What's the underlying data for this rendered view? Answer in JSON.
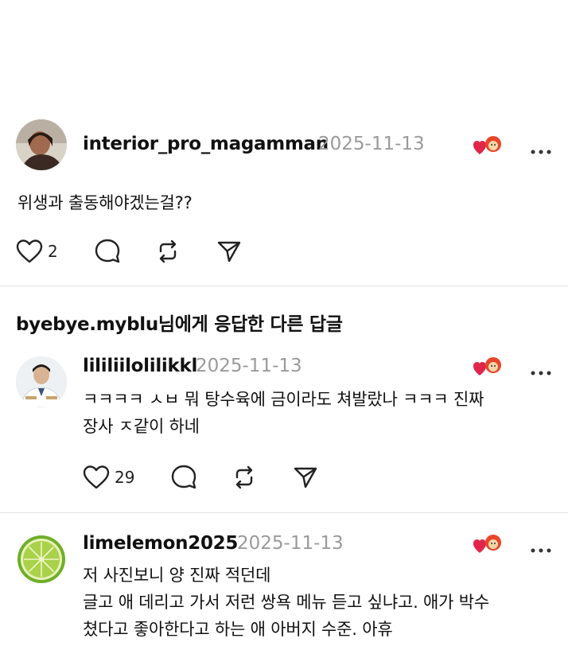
{
  "posts": [
    {
      "username": "interior_pro_magamman",
      "date": "2025-11-13",
      "lines": [
        "위생과 출동해야겠는걸??"
      ],
      "likes": "2",
      "avatar": "person-photo-avatar"
    },
    {
      "username": "lililiilolilikkl",
      "date": "2025-11-13",
      "lines": [
        "ㅋㅋㅋㅋ ㅅㅂ 뭐 탕수육에 금이라도 쳐발랐나 ㅋㅋㅋ 진짜",
        "장사 ㅈ같이 하네"
      ],
      "likes": "29",
      "avatar": "doctor-photo-avatar"
    },
    {
      "username": "limelemon2025",
      "date": "2025-11-13",
      "lines": [
        "저 사진보니 양 진짜 적던데",
        "글고 애 데리고 가서 저런 쌍욕 메뉴 듣고 싶냐고. 애가 박수",
        "쳤다고 좋아한다고 하는 애 아버지 수준. 아휴"
      ],
      "avatar": "lime-avatar"
    }
  ],
  "section": {
    "title": "byebye.myblu님에게 응답한 다른 답글"
  },
  "colors": {
    "reaction_heart": "#e0264a",
    "reaction_face": "#e8462c",
    "date_gray": "#9a9a9a",
    "icon_stroke": "#222222",
    "divider": "#e4e4e4"
  }
}
